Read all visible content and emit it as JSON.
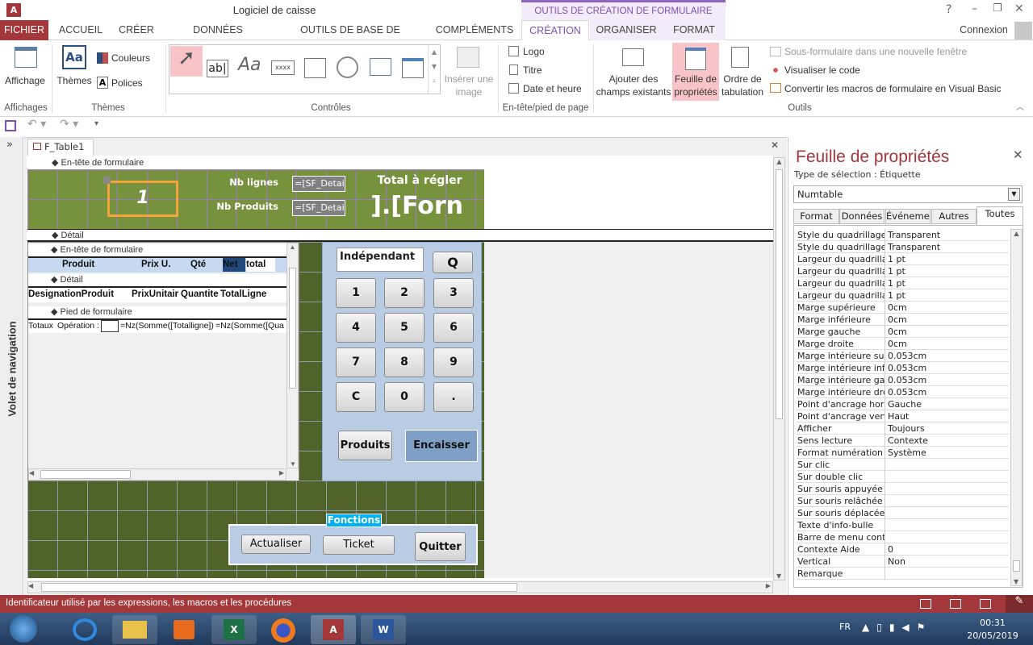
{
  "app": {
    "title": "Logiciel de caisse",
    "context_tab_group": "OUTILS DE CRÉATION DE FORMULAIRE",
    "signin": "Connexion",
    "help": "?",
    "minimize": "–",
    "restore": "❐",
    "close": "✕"
  },
  "tabs": [
    "FICHIER",
    "ACCUEIL",
    "CRÉER",
    "DONNÉES EXTERNES",
    "OUTILS DE BASE DE DONNÉES",
    "COMPLÉMENTS",
    "CRÉATION",
    "ORGANISER",
    "FORMAT"
  ],
  "ribbon": {
    "affichage": "Affichage",
    "affichages_group": "Affichages",
    "themes": "Thèmes",
    "couleurs": "Couleurs",
    "polices": "Polices",
    "themes_group": "Thèmes",
    "textbox_glyph": "ab|",
    "label_glyph": "Aa",
    "button_glyph": "xxxx",
    "inserer_image": [
      "Insérer une",
      "image"
    ],
    "controles_group": "Contrôles",
    "logo": "Logo",
    "titre": "Titre",
    "date_heure": "Date et heure",
    "entete_group": "En-tête/pied de page",
    "ajouter": [
      "Ajouter des",
      "champs existants"
    ],
    "feuille": [
      "Feuille de",
      "propriétés"
    ],
    "ordre": [
      "Ordre de",
      "tabulation"
    ],
    "sous_form": "Sous-formulaire dans une nouvelle fenêtre",
    "visualiser": "Visualiser le code",
    "convertir": "Convertir les macros de formulaire en Visual Basic",
    "outils_group": "Outils"
  },
  "nav_pane": {
    "label": "Volet de navigation",
    "toggle": "»"
  },
  "doc_tab": {
    "label": "F_Table1",
    "close": "✕"
  },
  "form": {
    "sections": {
      "header": "En-tête de formulaire",
      "detail": "Détail"
    },
    "header": {
      "numtable": "1",
      "nb_lignes": "Nb lignes",
      "nb_produits": "Nb Produits",
      "nb_lignes_value": "=[SF_Detail(",
      "nb_produits_value": "=[SF_Detail(",
      "total_label": "Total à régler",
      "total_value": "].[Forn"
    },
    "subform": {
      "header": "En-tête de formulaire",
      "detail": "Détail",
      "footer": "Pied de formulaire",
      "columns": [
        "Produit",
        "Prix U.",
        "Qté",
        "Net",
        "total"
      ],
      "fields": [
        "DesignationProduit",
        "PrixUnitair",
        "Quantite",
        "TotalLigne"
      ],
      "footer_cells": [
        "Totaux",
        "Opération :",
        "",
        "=Nz(Somme([Totalligne])",
        "=Nz(Somme([Qua"
      ]
    },
    "keypad": {
      "client": "Indépendant",
      "q": "Q",
      "keys": [
        "1",
        "2",
        "3",
        "4",
        "5",
        "6",
        "7",
        "8",
        "9",
        "C",
        "0",
        "."
      ],
      "produits": "Produits",
      "encaisser": "Encaisser"
    },
    "fonctions": {
      "label": "Fonctions",
      "actualiser": "Actualiser",
      "ticket": "Ticket",
      "quitter": "Quitter"
    }
  },
  "properties": {
    "title": "Feuille de propriétés",
    "selection_type": "Type de sélection :  Étiquette",
    "selected": "Numtable",
    "tabs": [
      "Format",
      "Données",
      "Événement",
      "Autres",
      "Toutes"
    ],
    "active_tab": "Toutes",
    "rows": [
      [
        "Style du quadrillage gauche",
        "Transparent"
      ],
      [
        "Style du quadrillage droit",
        "Transparent"
      ],
      [
        "Largeur du quadrillage haut",
        "1 pt"
      ],
      [
        "Largeur du quadrillage bas",
        "1 pt"
      ],
      [
        "Largeur du quadrillage gauche",
        "1 pt"
      ],
      [
        "Largeur du quadrillage droit",
        "1 pt"
      ],
      [
        "Marge supérieure",
        "0cm"
      ],
      [
        "Marge inférieure",
        "0cm"
      ],
      [
        "Marge gauche",
        "0cm"
      ],
      [
        "Marge droite",
        "0cm"
      ],
      [
        "Marge intérieure supérieure",
        "0.053cm"
      ],
      [
        "Marge intérieure inférieure",
        "0.053cm"
      ],
      [
        "Marge intérieure gauche",
        "0.053cm"
      ],
      [
        "Marge intérieure droite",
        "0.053cm"
      ],
      [
        "Point d'ancrage horizontal",
        "Gauche"
      ],
      [
        "Point d'ancrage vertical",
        "Haut"
      ],
      [
        "Afficher",
        "Toujours"
      ],
      [
        "Sens lecture",
        "Contexte"
      ],
      [
        "Format numération",
        "Système"
      ],
      [
        "Sur clic",
        ""
      ],
      [
        "Sur double clic",
        ""
      ],
      [
        "Sur souris appuyée",
        ""
      ],
      [
        "Sur souris relâchée",
        ""
      ],
      [
        "Sur souris déplacée",
        ""
      ],
      [
        "Texte d'info-bulle",
        ""
      ],
      [
        "Barre de menu contextuel",
        ""
      ],
      [
        "Contexte Aide",
        "0"
      ],
      [
        "Vertical",
        "Non"
      ],
      [
        "Remarque",
        ""
      ]
    ]
  },
  "status": {
    "text": "Identificateur utilisé par les expressions, les macros et les procédures"
  },
  "taskbar": {
    "lang": "FR",
    "time": "00:31",
    "date": "20/05/2019"
  },
  "colors": {
    "access_red": "#a4373a",
    "context_purple": "#7b4fb3",
    "form_green": "#76923c",
    "keypad_blue": "#b8cce4",
    "fonctions_cyan": "#00b0f0"
  }
}
